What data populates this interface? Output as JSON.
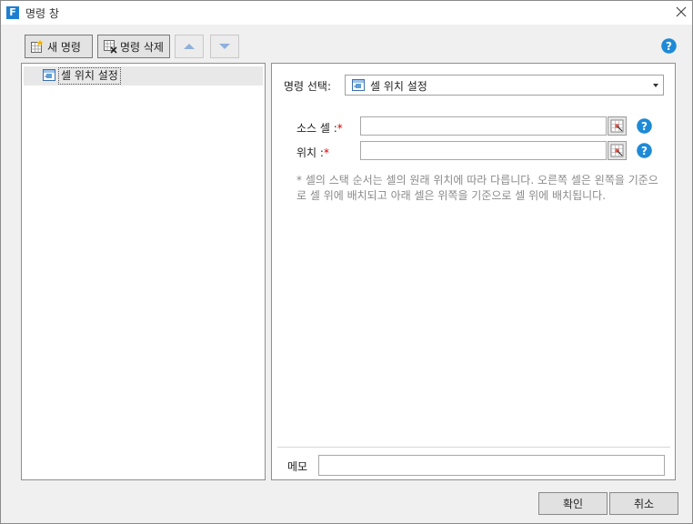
{
  "window": {
    "title": "명령 창",
    "app_icon_letter": "F"
  },
  "toolbar": {
    "new_command_label": "새 명령",
    "delete_command_label": "명령 삭제"
  },
  "tree": {
    "items": [
      {
        "label": "셀 위치 설정"
      }
    ]
  },
  "form": {
    "command_select_label": "명령 선택:",
    "command_select_value": "셀 위치 설정",
    "source_cell_label": "소스 셀 :",
    "position_label": "위치 :",
    "required_mark": "*",
    "note": "* 셀의 스택 순서는 셀의 원래 위치에 따라 다릅니다. 오른쪽 셀은 왼쪽을 기준으로 셀 위에 배치되고 아래 셀은 위쪽을 기준으로 셀 위에 배치됩니다.",
    "memo_label": "메모"
  },
  "footer": {
    "ok_label": "확인",
    "cancel_label": "취소"
  },
  "colors": {
    "accent": "#1e7fd1",
    "help": "#1e8ad6",
    "required": "#d00000"
  }
}
